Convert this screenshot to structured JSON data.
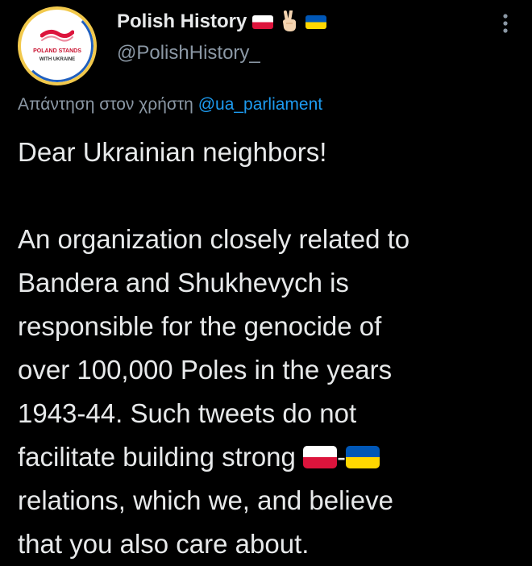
{
  "author": {
    "display_name": "Polish History",
    "handle": "@PolishHistory_",
    "avatar_text_line1": "POLAND STANDS",
    "avatar_text_line2": "WITH UKRAINE",
    "name_emojis": [
      "flag-poland-icon",
      "victory-hand-icon",
      "flag-ukraine-icon"
    ]
  },
  "reply": {
    "prefix": "Απάντηση στον χρήστη",
    "mention": "@ua_parliament"
  },
  "tweet": {
    "greeting": "Dear Ukrainian neighbors!",
    "lines": [
      "An organization closely related to",
      "Bandera and Shukhevych is",
      "responsible for the genocide of",
      "over 100,000 Poles in the years",
      "1943-44. Such tweets do not"
    ],
    "line_with_flags_before": "facilitate building strong ",
    "flags_separator": "-",
    "line_after_flags": [
      "relations, which we, and believe",
      "that you also care about."
    ]
  },
  "colors": {
    "background": "#000000",
    "text": "#e7e9ea",
    "secondary_text": "#8b98a5",
    "link": "#1d9bf0"
  }
}
